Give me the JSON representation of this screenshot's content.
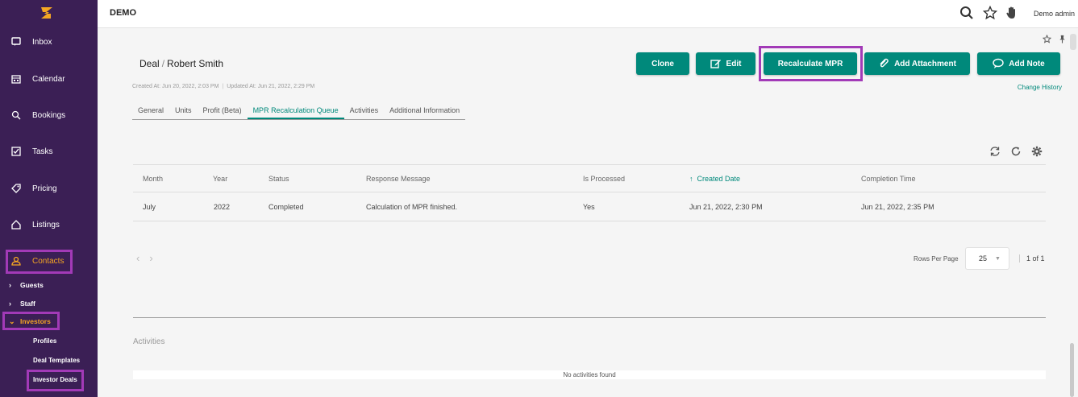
{
  "app": {
    "brand": "DEMO",
    "user": "Demo admin"
  },
  "sidebar": {
    "items": [
      {
        "label": "Inbox",
        "icon": "inbox-icon"
      },
      {
        "label": "Calendar",
        "icon": "calendar-icon"
      },
      {
        "label": "Bookings",
        "icon": "bookings-icon"
      },
      {
        "label": "Tasks",
        "icon": "tasks-icon"
      },
      {
        "label": "Pricing",
        "icon": "tag-icon"
      },
      {
        "label": "Listings",
        "icon": "home-icon"
      },
      {
        "label": "Contacts",
        "icon": "contacts-icon",
        "active": true
      }
    ],
    "sub": [
      {
        "label": "Guests"
      },
      {
        "label": "Staff"
      },
      {
        "label": "Investors",
        "active": true
      }
    ],
    "subsub": [
      {
        "label": "Profiles"
      },
      {
        "label": "Deal Templates"
      },
      {
        "label": "Investor Deals"
      }
    ]
  },
  "page": {
    "title_prefix": "Deal",
    "title_sep": "/",
    "title_name": "Robert Smith",
    "created": "Created At: Jun 20, 2022, 2:03 PM",
    "updated": "Updated At: Jun 21, 2022, 2:29 PM",
    "change_history": "Change History"
  },
  "actions": {
    "clone": "Clone",
    "edit": "Edit",
    "recalc": "Recalculate MPR",
    "attach": "Add Attachment",
    "note": "Add Note"
  },
  "tabs": [
    "General",
    "Units",
    "Profit (Beta)",
    "MPR Recalculation Queue",
    "Activities",
    "Additional Information"
  ],
  "table": {
    "headers": {
      "month": "Month",
      "year": "Year",
      "status": "Status",
      "response": "Response Message",
      "processed": "Is Processed",
      "created": "Created Date",
      "completion": "Completion Time"
    },
    "sort_arrow": "↑",
    "rows": [
      {
        "month": "July",
        "year": "2022",
        "status": "Completed",
        "response": "Calculation of MPR finished.",
        "processed": "Yes",
        "created": "Jun 21, 2022, 2:30 PM",
        "completion": "Jun 21, 2022, 2:35 PM"
      }
    ]
  },
  "pagination": {
    "rows_per_page_label": "Rows Per Page",
    "rows_per_page": "25",
    "page_info": "1 of 1"
  },
  "activities": {
    "title": "Activities",
    "empty": "No activities found"
  },
  "colors": {
    "accent": "#00897b",
    "sidebar": "#3b1f55",
    "highlight": "#a23ab7",
    "active": "#f5a623"
  }
}
